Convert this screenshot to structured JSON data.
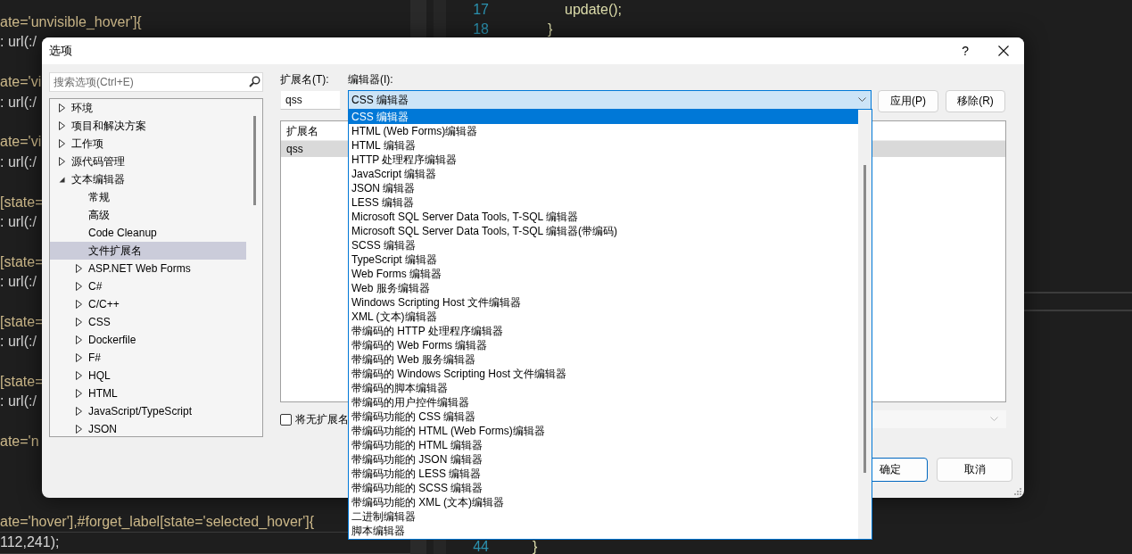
{
  "background_editor": {
    "left_pane": {
      "blocks": [
        [
          "ate='unvisible_hover']{",
          ": url(:/"
        ],
        [
          "ate='vi",
          ": url(:/"
        ],
        [
          "ate='vi",
          ": url(:/"
        ],
        [
          "[state=",
          ": url(:/"
        ],
        [
          "[state=",
          ": url(:/"
        ],
        [
          "[state=",
          ": url(:/"
        ],
        [
          "[state=",
          ": url(:/"
        ],
        [
          "ate='n"
        ],
        [
          "ate='hover'],#forget_label[state='selected_hover']{",
          "112,241);"
        ]
      ]
    },
    "middle_pane": {
      "top_lines": [
        {
          "number": "17",
          "code": "update();"
        },
        {
          "number": "18",
          "code": "}"
        }
      ],
      "bottom_lines": [
        {
          "number": "44",
          "code": "}"
        }
      ]
    }
  },
  "dialog": {
    "title": "选项",
    "help_button": "?",
    "search": {
      "placeholder": "搜索选项(Ctrl+E)"
    },
    "tree": {
      "items": [
        {
          "label": "环境",
          "expanded": false,
          "selected": false
        },
        {
          "label": "项目和解决方案",
          "expanded": false,
          "selected": false
        },
        {
          "label": "工作项",
          "expanded": false,
          "selected": false
        },
        {
          "label": "源代码管理",
          "expanded": false,
          "selected": false
        },
        {
          "label": "文本编辑器",
          "expanded": true,
          "selected": false,
          "children": [
            {
              "label": "常规",
              "selected": false
            },
            {
              "label": "高级",
              "selected": false
            },
            {
              "label": "Code Cleanup",
              "selected": false
            },
            {
              "label": "文件扩展名",
              "selected": true
            },
            {
              "label": "ASP.NET Web Forms",
              "expanded": false,
              "selected": false
            },
            {
              "label": "C#",
              "expanded": false,
              "selected": false
            },
            {
              "label": "C/C++",
              "expanded": false,
              "selected": false
            },
            {
              "label": "CSS",
              "expanded": false,
              "selected": false
            },
            {
              "label": "Dockerfile",
              "expanded": false,
              "selected": false
            },
            {
              "label": "F#",
              "expanded": false,
              "selected": false
            },
            {
              "label": "HQL",
              "expanded": false,
              "selected": false
            },
            {
              "label": "HTML",
              "expanded": false,
              "selected": false
            },
            {
              "label": "JavaScript/TypeScript",
              "expanded": false,
              "selected": false
            },
            {
              "label": "JSON",
              "expanded": false,
              "selected": false
            }
          ]
        }
      ]
    },
    "extension": {
      "label": "扩展名(T):",
      "value": "qss"
    },
    "editor": {
      "label": "编辑器(I):",
      "value": "CSS 编辑器",
      "expanded": true,
      "options": [
        {
          "label": "CSS 编辑器",
          "selected": true
        },
        {
          "label": "HTML (Web Forms)编辑器",
          "selected": false
        },
        {
          "label": "HTML 编辑器",
          "selected": false
        },
        {
          "label": "HTTP 处理程序编辑器",
          "selected": false
        },
        {
          "label": "JavaScript 编辑器",
          "selected": false
        },
        {
          "label": "JSON 编辑器",
          "selected": false
        },
        {
          "label": "LESS 编辑器",
          "selected": false
        },
        {
          "label": "Microsoft SQL Server Data Tools, T-SQL 编辑器",
          "selected": false
        },
        {
          "label": "Microsoft SQL Server Data Tools, T-SQL 编辑器(带编码)",
          "selected": false
        },
        {
          "label": "SCSS 编辑器",
          "selected": false
        },
        {
          "label": "TypeScript 编辑器",
          "selected": false
        },
        {
          "label": "Web Forms 编辑器",
          "selected": false
        },
        {
          "label": "Web 服务编辑器",
          "selected": false
        },
        {
          "label": "Windows Scripting Host 文件编辑器",
          "selected": false
        },
        {
          "label": "XML (文本)编辑器",
          "selected": false
        },
        {
          "label": "带编码的 HTTP 处理程序编辑器",
          "selected": false
        },
        {
          "label": "带编码的 Web Forms 编辑器",
          "selected": false
        },
        {
          "label": "带编码的 Web 服务编辑器",
          "selected": false
        },
        {
          "label": "带编码的 Windows Scripting Host 文件编辑器",
          "selected": false
        },
        {
          "label": "带编码的脚本编辑器",
          "selected": false
        },
        {
          "label": "带编码的用户控件编辑器",
          "selected": false
        },
        {
          "label": "带编码功能的 CSS 编辑器",
          "selected": false
        },
        {
          "label": "带编码功能的 HTML (Web Forms)编辑器",
          "selected": false
        },
        {
          "label": "带编码功能的 HTML 编辑器",
          "selected": false
        },
        {
          "label": "带编码功能的 JSON 编辑器",
          "selected": false
        },
        {
          "label": "带编码功能的 LESS 编辑器",
          "selected": false
        },
        {
          "label": "带编码功能的 SCSS 编辑器",
          "selected": false
        },
        {
          "label": "带编码功能的 XML (文本)编辑器",
          "selected": false
        },
        {
          "label": "二进制编辑器",
          "selected": false
        },
        {
          "label": "脚本编辑器",
          "selected": false
        }
      ]
    },
    "actions": [
      {
        "label": "应用(P)"
      },
      {
        "label": "移除(R)"
      }
    ],
    "list": {
      "columns": [
        "扩展名"
      ],
      "rows": [
        {
          "cells": [
            "qss"
          ],
          "selected": true
        }
      ]
    },
    "no_extension": {
      "label": "将无扩展名",
      "checked": false
    },
    "mapping_combo": {
      "disabled": true
    },
    "footer_buttons": [
      {
        "label": "确定",
        "default": true
      },
      {
        "label": "取消",
        "default": false
      }
    ]
  }
}
